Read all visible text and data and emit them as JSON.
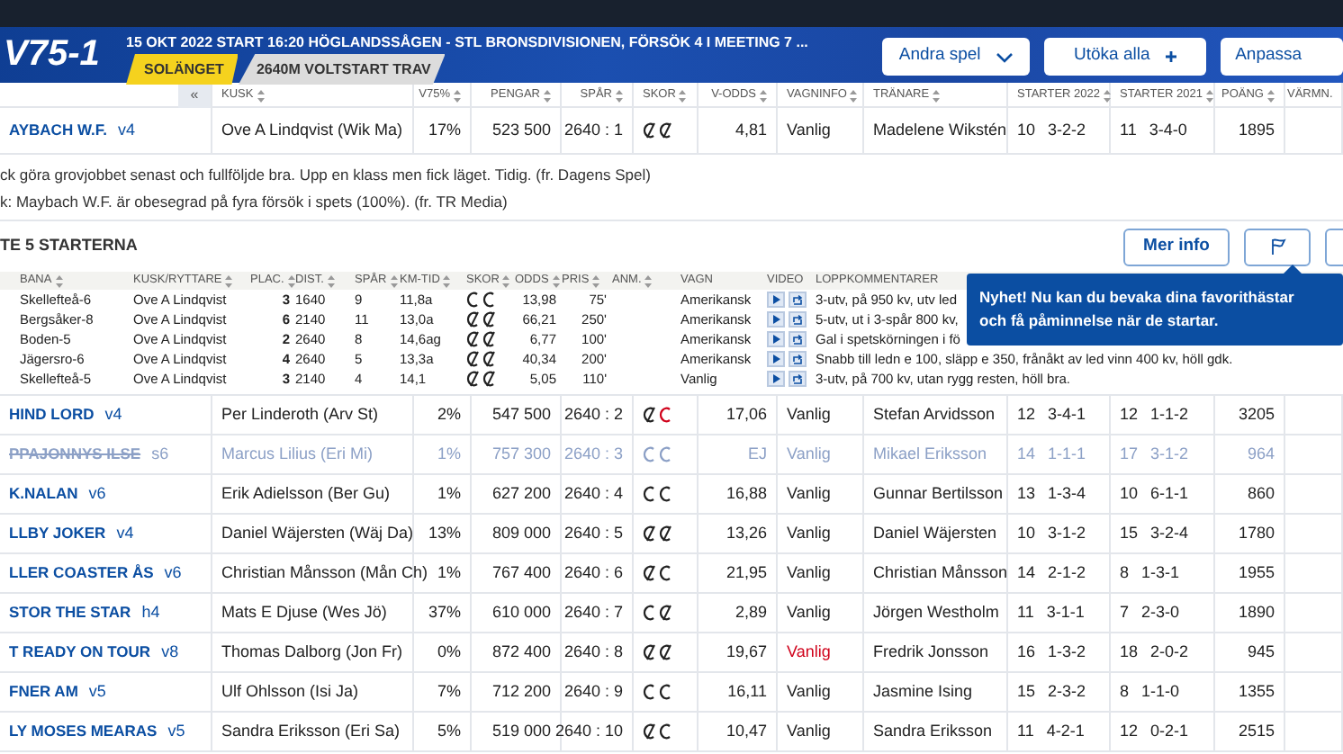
{
  "header": {
    "game": "V75-1",
    "title": "15 OKT 2022 START 16:20 HÖGLANDSSÅGEN - STL BRONSDIVISIONEN, FÖRSÖK 4 I MEETING 7 ...",
    "tags": [
      {
        "label": "SOLÄNGET",
        "color": "#f5d21e"
      },
      {
        "label": "2640M VOLTSTART TRAV",
        "color": "#dcdcdc"
      }
    ],
    "buttons": [
      {
        "label": "Andra spel"
      },
      {
        "label": "Utöka alla"
      },
      {
        "label": "Anpassa"
      }
    ]
  },
  "collapse_button": "«",
  "columns": [
    {
      "label": "KUSK",
      "sortable": true
    },
    {
      "label": "V75%",
      "sortable": true
    },
    {
      "label": "PENGAR",
      "sortable": true
    },
    {
      "label": "SPÅR",
      "sortable": true
    },
    {
      "label": "SKOR",
      "sortable": true
    },
    {
      "label": "V-ODDS",
      "sortable": true
    },
    {
      "label": "VAGNINFO",
      "sortable": true
    },
    {
      "label": "TRÄNARE",
      "sortable": true
    },
    {
      "label": "STARTER 2022",
      "sortable": true
    },
    {
      "label": "STARTER 2021",
      "sortable": true
    },
    {
      "label": "POÄNG",
      "sortable": true
    },
    {
      "label": "VÄRMN.",
      "sortable": false
    }
  ],
  "horses": [
    {
      "name": "AYBACH W.F.",
      "age_sex": "v4",
      "driver": "Ove A Lindqvist (Wik Ma)",
      "v75": "17%",
      "money": "523 500",
      "post": "2640 : 1",
      "shoes": [
        {
          "barefoot": true,
          "changed": false
        },
        {
          "barefoot": true,
          "changed": false
        }
      ],
      "odds": "4,81",
      "cart": "Vanlig",
      "cart_changed": false,
      "trainer": "Madelene Wikstén",
      "starts_2022": "10",
      "record_2022": "3-2-2",
      "starts_2021": "11",
      "record_2021": "3-4-0",
      "points": "1895",
      "scratched": false,
      "details": {
        "comments": [
          "ck göra grovjobbet senast och fullföljde bra. Upp en klass men fick läget. Tidig. (fr. Dagens Spel)",
          "k: Maybach W.F. är obesegrad på fyra försök i spets (100%). (fr. TR Media)"
        ],
        "title": "TE 5 STARTERNA",
        "more_button": "Mer info",
        "columns": [
          {
            "label": "BANA",
            "sortable": true
          },
          {
            "label": "KUSK/RYTTARE",
            "sortable": true
          },
          {
            "label": "PLAC.",
            "sortable": true
          },
          {
            "label": "DIST.",
            "sortable": true
          },
          {
            "label": "SPÅR",
            "sortable": true
          },
          {
            "label": "KM-TID",
            "sortable": true
          },
          {
            "label": "SKOR",
            "sortable": true
          },
          {
            "label": "ODDS",
            "sortable": true
          },
          {
            "label": "PRIS",
            "sortable": true
          },
          {
            "label": "ANM.",
            "sortable": true
          },
          {
            "label": "VAGN",
            "sortable": false
          },
          {
            "label": "VIDEO",
            "sortable": false
          },
          {
            "label": "LOPPKOMMENTARER",
            "sortable": false
          }
        ],
        "starts": [
          {
            "track": "Skellefteå-6",
            "driver": "Ove A Lindqvist",
            "place": "3",
            "dist": "1640",
            "post": "9",
            "time": "11,8a",
            "shoes": [
              {
                "barefoot": false,
                "changed": false
              },
              {
                "barefoot": false,
                "changed": false
              }
            ],
            "odds": "13,98",
            "prize": "75'",
            "cart": "Amerikansk",
            "comment": "3-utv, på 950 kv, utv led"
          },
          {
            "track": "Bergsåker-8",
            "driver": "Ove A Lindqvist",
            "place": "6",
            "dist": "2140",
            "post": "11",
            "time": "13,0a",
            "shoes": [
              {
                "barefoot": true,
                "changed": false
              },
              {
                "barefoot": true,
                "changed": false
              }
            ],
            "odds": "66,21",
            "prize": "250'",
            "cart": "Amerikansk",
            "comment": "5-utv, ut i 3-spår 800 kv,"
          },
          {
            "track": "Boden-5",
            "driver": "Ove A Lindqvist",
            "place": "2",
            "dist": "2640",
            "post": "8",
            "time": "14,6ag",
            "shoes": [
              {
                "barefoot": true,
                "changed": false
              },
              {
                "barefoot": true,
                "changed": false
              }
            ],
            "odds": "6,77",
            "prize": "100'",
            "cart": "Amerikansk",
            "comment": "Gal i spetskörningen i fö"
          },
          {
            "track": "Jägersro-6",
            "driver": "Ove A Lindqvist",
            "place": "4",
            "dist": "2640",
            "post": "5",
            "time": "13,3a",
            "shoes": [
              {
                "barefoot": true,
                "changed": false
              },
              {
                "barefoot": true,
                "changed": false
              }
            ],
            "odds": "40,34",
            "prize": "200'",
            "cart": "Amerikansk",
            "comment": "Snabb till ledn e 100, släpp e 350, frånåkt av led vinn 400 kv, höll gdk."
          },
          {
            "track": "Skellefteå-5",
            "driver": "Ove A Lindqvist",
            "place": "3",
            "dist": "2140",
            "post": "4",
            "time": "14,1",
            "shoes": [
              {
                "barefoot": true,
                "changed": false
              },
              {
                "barefoot": true,
                "changed": false
              }
            ],
            "odds": "5,05",
            "prize": "110'",
            "cart": "Vanlig",
            "comment": "3-utv, på 700 kv, utan rygg resten, höll bra."
          }
        ],
        "tooltip": "Nyhet! Nu kan du bevaka dina favorithästar och få påminnelse när de startar."
      }
    },
    {
      "name": "HIND LORD",
      "age_sex": "v4",
      "driver": "Per Linderoth (Arv St)",
      "v75": "2%",
      "money": "547 500",
      "post": "2640 : 2",
      "shoes": [
        {
          "barefoot": true,
          "changed": false
        },
        {
          "barefoot": false,
          "changed": true
        }
      ],
      "odds": "17,06",
      "cart": "Vanlig",
      "cart_changed": false,
      "trainer": "Stefan Arvidsson",
      "starts_2022": "12",
      "record_2022": "3-4-1",
      "starts_2021": "12",
      "record_2021": "1-1-2",
      "points": "3205",
      "scratched": false
    },
    {
      "name": "PPAJONNYS ILSE",
      "age_sex": "s6",
      "driver": "Marcus Lilius (Eri Mi)",
      "v75": "1%",
      "money": "757 300",
      "post": "2640 : 3",
      "shoes": [
        {
          "barefoot": false,
          "changed": false
        },
        {
          "barefoot": false,
          "changed": false
        }
      ],
      "odds": "EJ",
      "cart": "Vanlig",
      "cart_changed": false,
      "trainer": "Mikael Eriksson",
      "starts_2022": "14",
      "record_2022": "1-1-1",
      "starts_2021": "17",
      "record_2021": "3-1-2",
      "points": "964",
      "scratched": true
    },
    {
      "name": "K.NALAN",
      "age_sex": "v6",
      "driver": "Erik Adielsson (Ber Gu)",
      "v75": "1%",
      "money": "627 200",
      "post": "2640 : 4",
      "shoes": [
        {
          "barefoot": false,
          "changed": false
        },
        {
          "barefoot": false,
          "changed": false
        }
      ],
      "odds": "16,88",
      "cart": "Vanlig",
      "cart_changed": false,
      "trainer": "Gunnar Bertilsson",
      "starts_2022": "13",
      "record_2022": "1-3-4",
      "starts_2021": "10",
      "record_2021": "6-1-1",
      "points": "860",
      "scratched": false
    },
    {
      "name": "LLBY JOKER",
      "age_sex": "v4",
      "driver": "Daniel Wäjersten (Wäj Da)",
      "v75": "13%",
      "money": "809 000",
      "post": "2640 : 5",
      "shoes": [
        {
          "barefoot": true,
          "changed": false
        },
        {
          "barefoot": true,
          "changed": false
        }
      ],
      "odds": "13,26",
      "cart": "Vanlig",
      "cart_changed": false,
      "trainer": "Daniel Wäjersten",
      "starts_2022": "10",
      "record_2022": "3-1-2",
      "starts_2021": "15",
      "record_2021": "3-2-4",
      "points": "1780",
      "scratched": false
    },
    {
      "name": "LLER COASTER ÅS",
      "age_sex": "v6",
      "driver": "Christian Månsson (Mån Ch)",
      "v75": "1%",
      "money": "767 400",
      "post": "2640 : 6",
      "shoes": [
        {
          "barefoot": true,
          "changed": false
        },
        {
          "barefoot": false,
          "changed": false
        }
      ],
      "odds": "21,95",
      "cart": "Vanlig",
      "cart_changed": false,
      "trainer": "Christian Månsson",
      "starts_2022": "14",
      "record_2022": "2-1-2",
      "starts_2021": "8",
      "record_2021": "1-3-1",
      "points": "1955",
      "scratched": false
    },
    {
      "name": "STOR THE STAR",
      "age_sex": "h4",
      "driver": "Mats E Djuse (Wes Jö)",
      "v75": "37%",
      "money": "610 000",
      "post": "2640 : 7",
      "shoes": [
        {
          "barefoot": false,
          "changed": false
        },
        {
          "barefoot": true,
          "changed": false
        }
      ],
      "odds": "2,89",
      "cart": "Vanlig",
      "cart_changed": false,
      "trainer": "Jörgen Westholm",
      "starts_2022": "11",
      "record_2022": "3-1-1",
      "starts_2021": "7",
      "record_2021": "2-3-0",
      "points": "1890",
      "scratched": false
    },
    {
      "name": "T READY ON TOUR",
      "age_sex": "v8",
      "driver": "Thomas Dalborg (Jon Fr)",
      "v75": "0%",
      "money": "872 400",
      "post": "2640 : 8",
      "shoes": [
        {
          "barefoot": true,
          "changed": false
        },
        {
          "barefoot": true,
          "changed": false
        }
      ],
      "odds": "19,67",
      "cart": "Vanlig",
      "cart_changed": true,
      "trainer": "Fredrik Jonsson",
      "starts_2022": "16",
      "record_2022": "1-3-2",
      "starts_2021": "18",
      "record_2021": "2-0-2",
      "points": "945",
      "scratched": false
    },
    {
      "name": "FNER AM",
      "age_sex": "v5",
      "driver": "Ulf Ohlsson (Isi Ja)",
      "v75": "7%",
      "money": "712 200",
      "post": "2640 : 9",
      "shoes": [
        {
          "barefoot": false,
          "changed": false
        },
        {
          "barefoot": false,
          "changed": false
        }
      ],
      "odds": "16,11",
      "cart": "Vanlig",
      "cart_changed": false,
      "trainer": "Jasmine Ising",
      "starts_2022": "15",
      "record_2022": "2-3-2",
      "starts_2021": "8",
      "record_2021": "1-1-0",
      "points": "1355",
      "scratched": false
    },
    {
      "name": "LY MOSES MEARAS",
      "age_sex": "v5",
      "driver": "Sandra Eriksson (Eri Sa)",
      "v75": "5%",
      "money": "519 000",
      "post": "2640 : 10",
      "shoes": [
        {
          "barefoot": true,
          "changed": false
        },
        {
          "barefoot": false,
          "changed": false
        }
      ],
      "odds": "10,47",
      "cart": "Vanlig",
      "cart_changed": false,
      "trainer": "Sandra Eriksson",
      "starts_2022": "11",
      "record_2022": "4-2-1",
      "starts_2021": "12",
      "record_2021": "0-2-1",
      "points": "2515",
      "scratched": false
    }
  ]
}
